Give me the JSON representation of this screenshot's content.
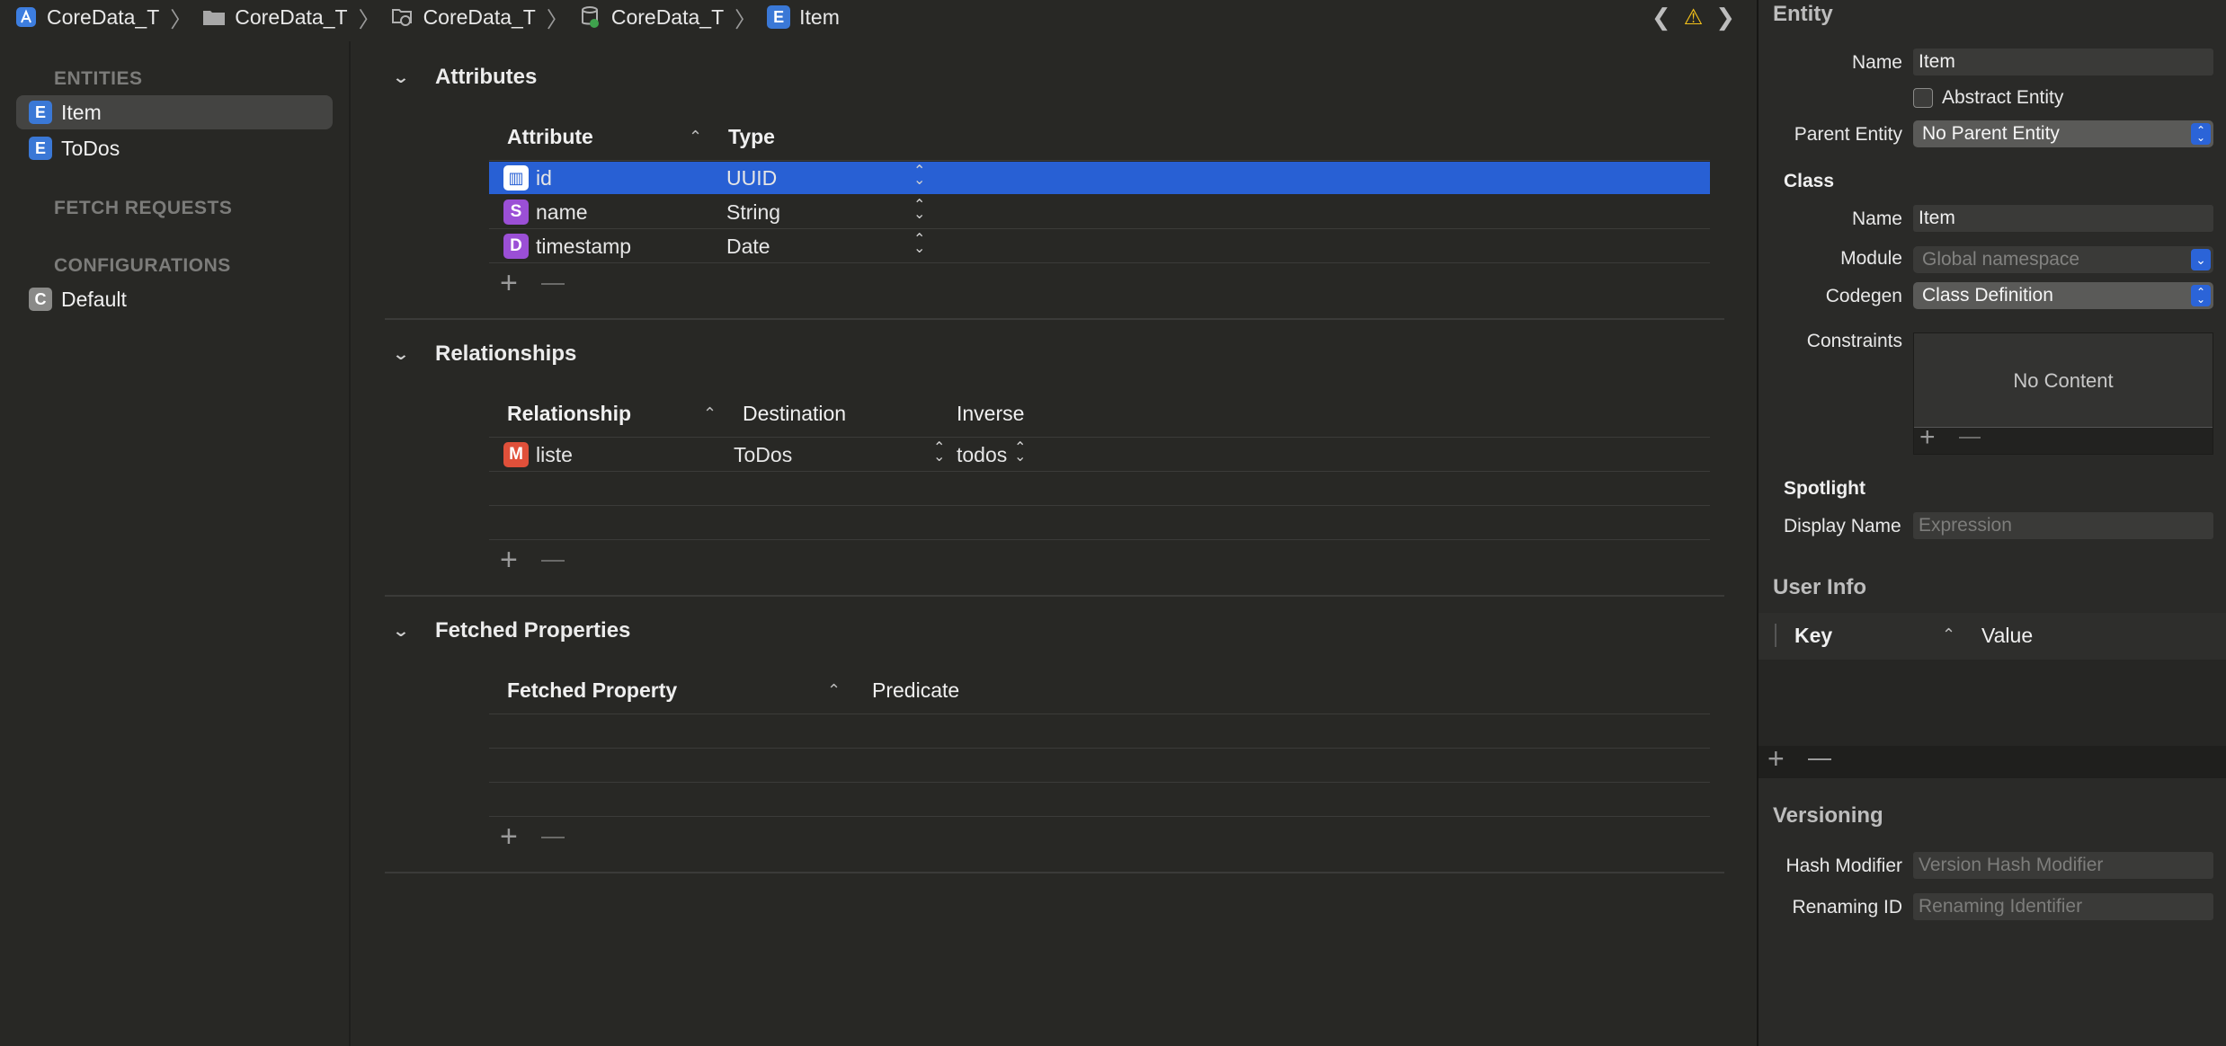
{
  "jumpbar": {
    "crumbs": [
      {
        "icon": "xcode-project-icon",
        "label": "CoreData_T"
      },
      {
        "icon": "folder-icon",
        "label": "CoreData_T"
      },
      {
        "icon": "group-folder-icon",
        "label": "CoreData_T"
      },
      {
        "icon": "datamodel-icon",
        "label": "CoreData_T"
      },
      {
        "icon": "entity-icon",
        "badge": "E",
        "label": "Item"
      }
    ],
    "nav_back": "❮",
    "warning": "⚠",
    "nav_forward": "❯"
  },
  "sidebar": {
    "entities_title": "ENTITIES",
    "entities": [
      {
        "badge": "E",
        "label": "Item",
        "selected": true
      },
      {
        "badge": "E",
        "label": "ToDos",
        "selected": false
      }
    ],
    "fetch_requests_title": "FETCH REQUESTS",
    "configurations_title": "CONFIGURATIONS",
    "configurations": [
      {
        "badge": "C",
        "label": "Default"
      }
    ]
  },
  "editor": {
    "attributes": {
      "title": "Attributes",
      "col_attribute": "Attribute",
      "col_type": "Type",
      "rows": [
        {
          "badge": "▥",
          "name": "id",
          "type": "UUID",
          "selected": true
        },
        {
          "badge": "S",
          "name": "name",
          "type": "String",
          "selected": false
        },
        {
          "badge": "D",
          "name": "timestamp",
          "type": "Date",
          "selected": false
        }
      ]
    },
    "relationships": {
      "title": "Relationships",
      "col_relationship": "Relationship",
      "col_destination": "Destination",
      "col_inverse": "Inverse",
      "rows": [
        {
          "badge": "M",
          "name": "liste",
          "destination": "ToDos",
          "inverse": "todos"
        }
      ]
    },
    "fetched": {
      "title": "Fetched Properties",
      "col_property": "Fetched Property",
      "col_predicate": "Predicate"
    },
    "plus": "+"
  },
  "inspector": {
    "entity_title": "Entity",
    "name_label": "Name",
    "name_value": "Item",
    "abstract_label": "Abstract Entity",
    "parent_label": "Parent Entity",
    "parent_value": "No Parent Entity",
    "class_title": "Class",
    "class_name_label": "Name",
    "class_name_value": "Item",
    "module_label": "Module",
    "module_placeholder": "Global namespace",
    "codegen_label": "Codegen",
    "codegen_value": "Class Definition",
    "constraints_label": "Constraints",
    "constraints_empty": "No Content",
    "spotlight_title": "Spotlight",
    "display_name_label": "Display Name",
    "display_name_placeholder": "Expression",
    "userinfo_title": "User Info",
    "col_key": "Key",
    "col_value": "Value",
    "versioning_title": "Versioning",
    "hash_label": "Hash Modifier",
    "hash_placeholder": "Version Hash Modifier",
    "renaming_label": "Renaming ID",
    "renaming_placeholder": "Renaming Identifier",
    "plus": "+"
  },
  "colors": {
    "selection": "#2860d4",
    "entity_badge": "#3a78d6",
    "string_badge": "#9b4fd6",
    "date_badge": "#9b4fd6",
    "rel_badge": "#e0503a",
    "config_badge": "#8a8a88",
    "warning": "#f6c31a"
  }
}
